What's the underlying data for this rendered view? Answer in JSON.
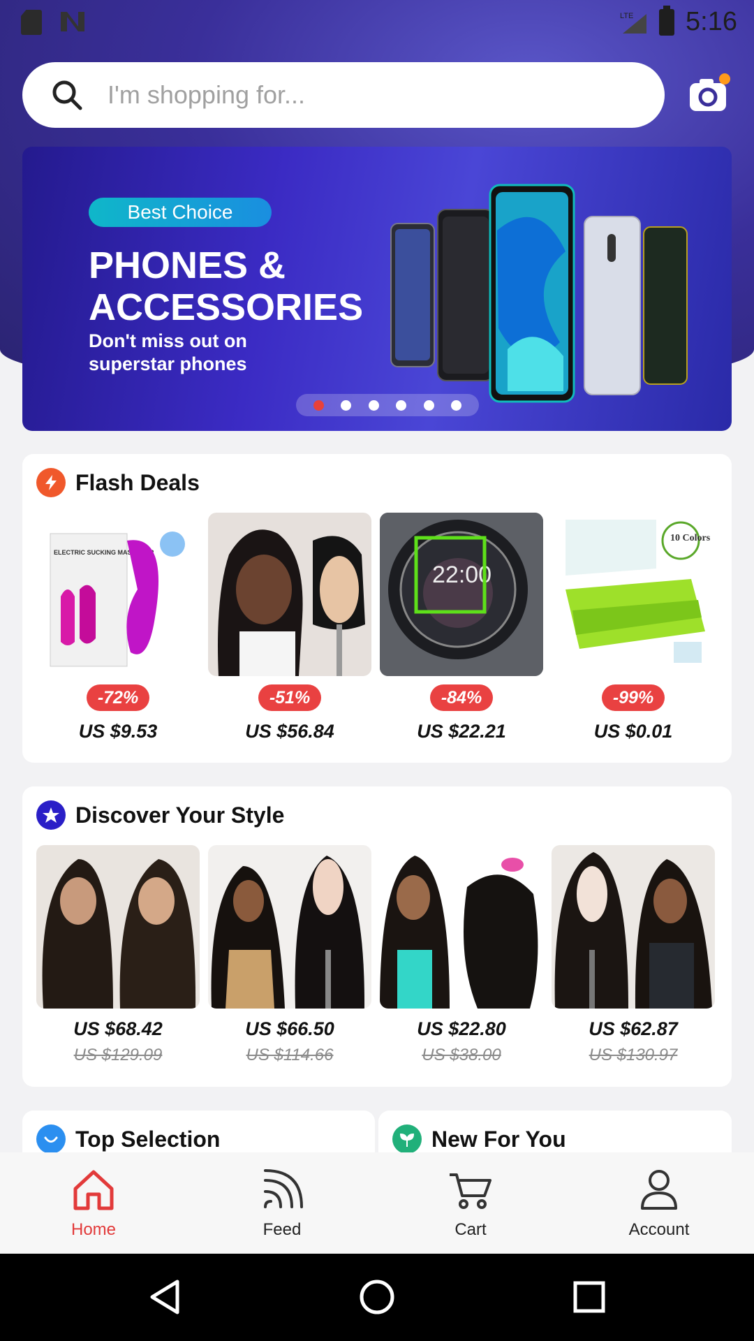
{
  "status_bar": {
    "network": "LTE",
    "time": "5:16"
  },
  "search": {
    "placeholder": "I'm shopping for..."
  },
  "banner": {
    "pill": "Best Choice",
    "headline": "PHONES & ACCESSORIES",
    "subtitle": "Don't miss out on superstar phones",
    "slides": 6,
    "active_slide": 1
  },
  "flash_deals": {
    "title": "Flash Deals",
    "items": [
      {
        "discount": "-72%",
        "price": "US $9.53",
        "image_text": "ELECTRIC SUCKING MASSAGER"
      },
      {
        "discount": "-51%",
        "price": "US $56.84"
      },
      {
        "discount": "-84%",
        "price": "US $22.21",
        "image_text": "22:00"
      },
      {
        "discount": "-99%",
        "price": "US $0.01",
        "image_text": "10 Colors"
      }
    ]
  },
  "discover": {
    "title": "Discover Your Style",
    "items": [
      {
        "price": "US $68.42",
        "old_price": "US $129.09"
      },
      {
        "price": "US $66.50",
        "old_price": "US $114.66"
      },
      {
        "price": "US $22.80",
        "old_price": "US $38.00"
      },
      {
        "price": "US $62.87",
        "old_price": "US $130.97"
      }
    ]
  },
  "sections": {
    "top_selection": "Top Selection",
    "new_for_you": "New For You"
  },
  "nav": {
    "items": [
      {
        "label": "Home",
        "icon": "home-icon",
        "active": true
      },
      {
        "label": "Feed",
        "icon": "feed-icon",
        "active": false
      },
      {
        "label": "Cart",
        "icon": "cart-icon",
        "active": false
      },
      {
        "label": "Account",
        "icon": "account-icon",
        "active": false
      }
    ]
  },
  "colors": {
    "accent": "#e94141",
    "brand": "#3b2bc4",
    "nav_active": "#e23a3a"
  }
}
